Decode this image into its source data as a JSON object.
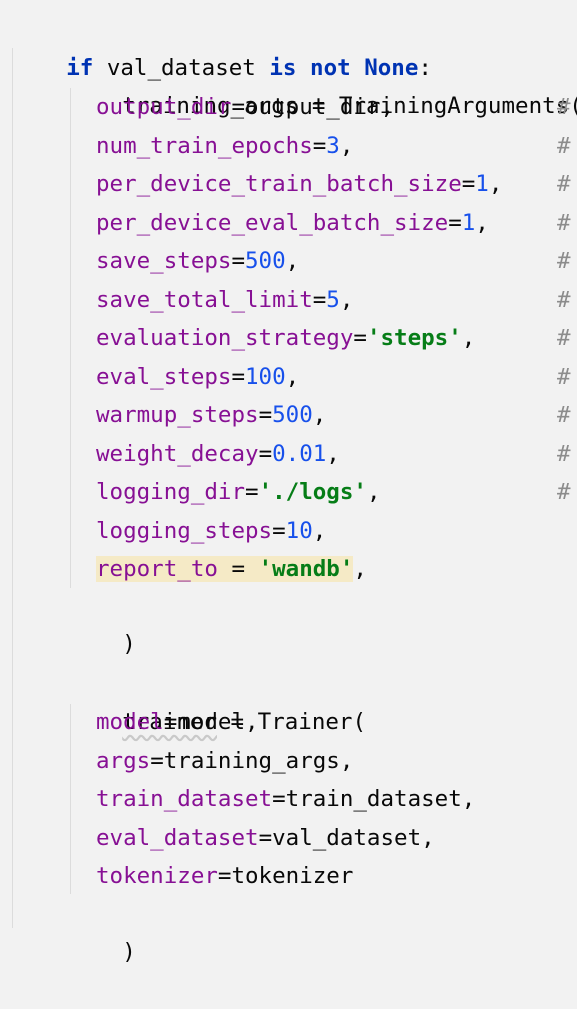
{
  "code": {
    "line1": {
      "kw_if": "if",
      "name": "val_dataset",
      "kw_is": "is",
      "kw_not": "not",
      "kw_none": "None",
      "colon": ":"
    },
    "line2": {
      "text": "training_args = TrainingArguments("
    },
    "args": [
      {
        "param": "output_dir",
        "eq": "=",
        "value": "output_dir",
        "value_type": "plain",
        "tail": ","
      },
      {
        "param": "num_train_epochs",
        "eq": "=",
        "value": "3",
        "value_type": "num",
        "tail": ","
      },
      {
        "param": "per_device_train_batch_size",
        "eq": "=",
        "value": "1",
        "value_type": "num",
        "tail": ","
      },
      {
        "param": "per_device_eval_batch_size",
        "eq": "=",
        "value": "1",
        "value_type": "num",
        "tail": ","
      },
      {
        "param": "save_steps",
        "eq": "=",
        "value": "500",
        "value_type": "num",
        "tail": ","
      },
      {
        "param": "save_total_limit",
        "eq": "=",
        "value": "5",
        "value_type": "num",
        "tail": ","
      },
      {
        "param": "evaluation_strategy",
        "eq": "=",
        "value": "'steps'",
        "value_type": "str",
        "tail": ","
      },
      {
        "param": "eval_steps",
        "eq": "=",
        "value": "100",
        "value_type": "num",
        "tail": ","
      },
      {
        "param": "warmup_steps",
        "eq": "=",
        "value": "500",
        "value_type": "num",
        "tail": ","
      },
      {
        "param": "weight_decay",
        "eq": "=",
        "value": "0.01",
        "value_type": "num",
        "tail": ","
      },
      {
        "param": "logging_dir",
        "eq": "=",
        "value": "'./logs'",
        "value_type": "str",
        "tail": ","
      },
      {
        "param": "logging_steps",
        "eq": "=",
        "value": "10",
        "value_type": "num",
        "tail": ","
      },
      {
        "param": "report_to",
        "eq": " = ",
        "value": "'wandb'",
        "value_type": "str",
        "tail": ","
      }
    ],
    "comment_marker": "#",
    "close_paren": ")",
    "trainer_line": {
      "name": "trainer",
      "rest": " = Trainer("
    },
    "trainer_args": [
      {
        "param": "model",
        "value": "model",
        "tail": ","
      },
      {
        "param": "args",
        "value": "training_args",
        "tail": ","
      },
      {
        "param": "train_dataset",
        "value": "train_dataset",
        "tail": ","
      },
      {
        "param": "eval_dataset",
        "value": "val_dataset",
        "tail": ","
      },
      {
        "param": "tokenizer",
        "value": "tokenizer",
        "tail": ""
      }
    ]
  },
  "colors": {
    "background": "#f2f2f2",
    "keyword": "#0033b3",
    "parameter": "#871094",
    "number": "#1750eb",
    "string": "#067d17",
    "highlight": "#f5eac6"
  }
}
